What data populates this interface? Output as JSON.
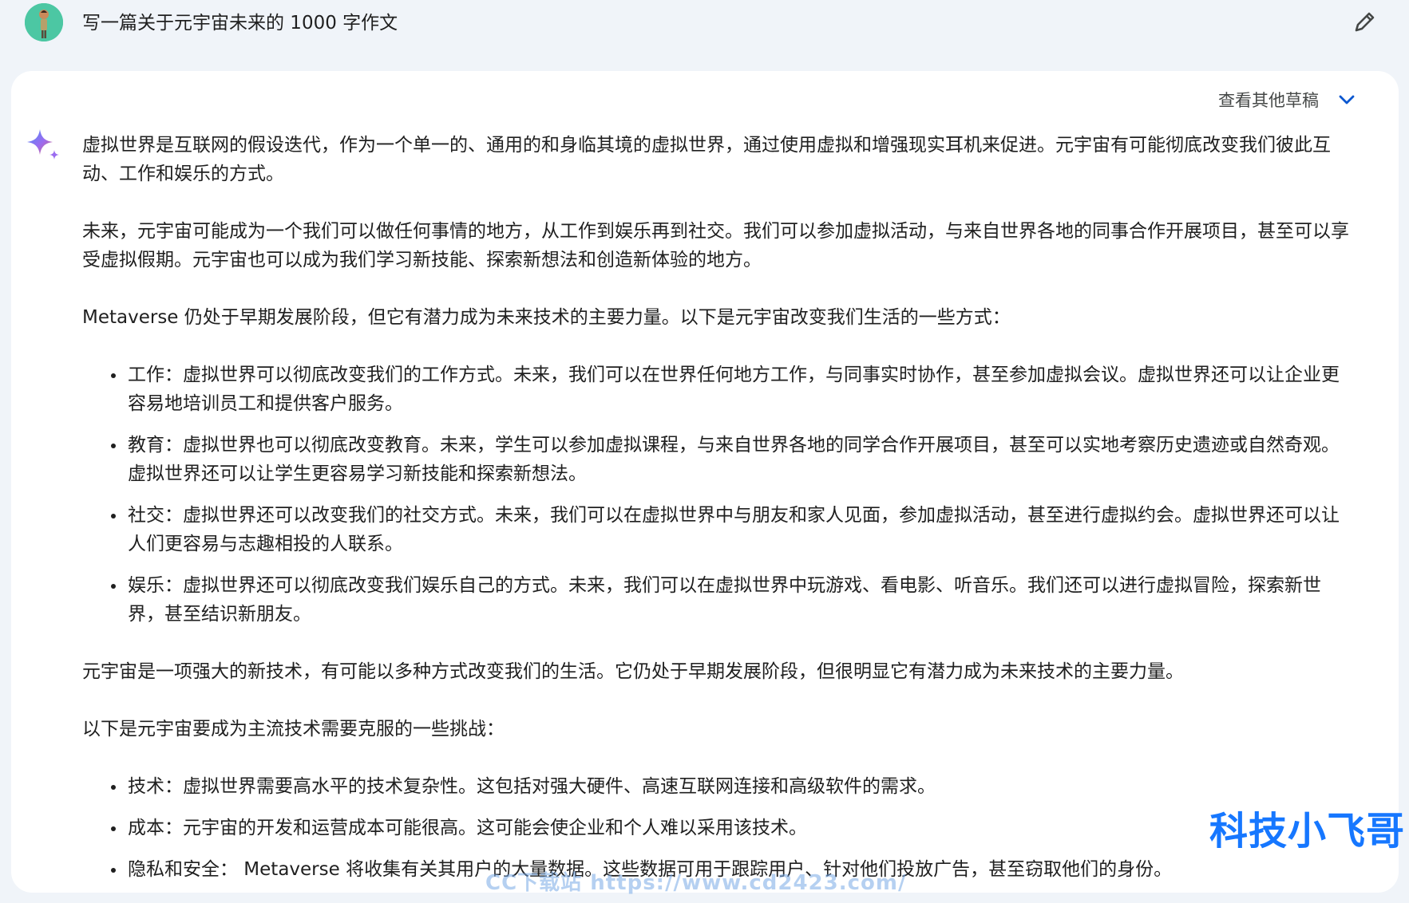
{
  "prompt": {
    "text": "写一篇关于元宇宙未来的 1000 字作文",
    "avatar_icon": "user-avatar",
    "edit_icon": "pencil-icon"
  },
  "response": {
    "drafts_label": "查看其他草稿",
    "drafts_icon": "chevron-down-icon",
    "assistant_icon": "sparkle-icon",
    "paragraphs": [
      "虚拟世界是互联网的假设迭代，作为一个单一的、通用的和身临其境的虚拟世界，通过使用虚拟和增强现实耳机来促进。元宇宙有可能彻底改变我们彼此互动、工作和娱乐的方式。",
      "未来，元宇宙可能成为一个我们可以做任何事情的地方，从工作到娱乐再到社交。我们可以参加虚拟活动，与来自世界各地的同事合作开展项目，甚至可以享受虚拟假期。元宇宙也可以成为我们学习新技能、探索新想法和创造新体验的地方。",
      "Metaverse 仍处于早期发展阶段，但它有潜力成为未来技术的主要力量。以下是元宇宙改变我们生活的一些方式："
    ],
    "list1": [
      "工作：虚拟世界可以彻底改变我们的工作方式。未来，我们可以在世界任何地方工作，与同事实时协作，甚至参加虚拟会议。虚拟世界还可以让企业更容易地培训员工和提供客户服务。",
      "教育：虚拟世界也可以彻底改变教育。未来，学生可以参加虚拟课程，与来自世界各地的同学合作开展项目，甚至可以实地考察历史遗迹或自然奇观。虚拟世界还可以让学生更容易学习新技能和探索新想法。",
      "社交：虚拟世界还可以改变我们的社交方式。未来，我们可以在虚拟世界中与朋友和家人见面，参加虚拟活动，甚至进行虚拟约会。虚拟世界还可以让人们更容易与志趣相投的人联系。",
      "娱乐：虚拟世界还可以彻底改变我们娱乐自己的方式。未来，我们可以在虚拟世界中玩游戏、看电影、听音乐。我们还可以进行虚拟冒险，探索新世界，甚至结识新朋友。"
    ],
    "paragraph4": "元宇宙是一项强大的新技术，有可能以多种方式改变我们的生活。它仍处于早期发展阶段，但很明显它有潜力成为未来技术的主要力量。",
    "paragraph5": "以下是元宇宙要成为主流技术需要克服的一些挑战：",
    "list2": [
      "技术：虚拟世界需要高水平的技术复杂性。这包括对强大硬件、高速互联网连接和高级软件的需求。",
      "成本：元宇宙的开发和运营成本可能很高。这可能会使企业和个人难以采用该技术。",
      "隐私和安全： Metaverse 将收集有关其用户的大量数据。这些数据可用于跟踪用户、针对他们投放广告，甚至窃取他们的身份。"
    ]
  },
  "watermark": {
    "text": "科技小飞哥",
    "url_text": "CC下载站 https://www.cd2423.com/"
  }
}
